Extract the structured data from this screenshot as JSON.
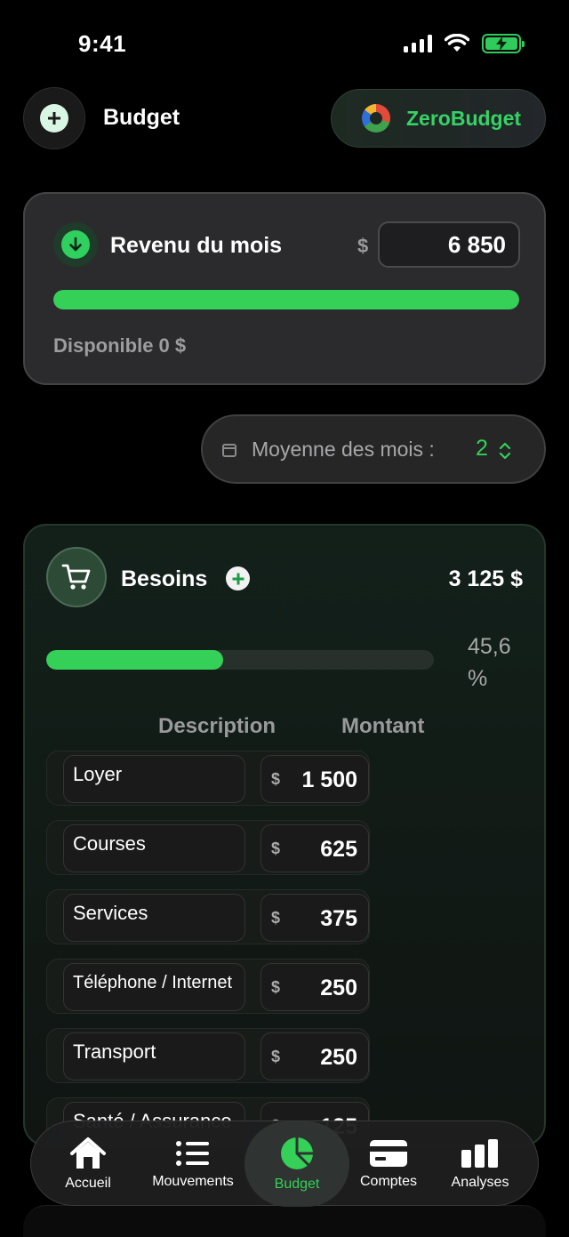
{
  "status_bar": {
    "time": "9:41"
  },
  "header": {
    "title": "Budget",
    "brand_name": "ZeroBudget"
  },
  "income": {
    "title": "Revenu du mois",
    "currency": "$",
    "amount": "6 850",
    "progress_fraction": 1.0,
    "available_text": "Disponible 0 $"
  },
  "months_average": {
    "label": "Moyenne des mois :",
    "value": "2"
  },
  "needs": {
    "title": "Besoins",
    "total": "3 125 $",
    "percent_text": "45,6 %",
    "percent_fraction": 0.456,
    "column_description": "Description",
    "column_amount": "Montant",
    "currency": "$",
    "rows": [
      {
        "description": "Loyer",
        "amount": "1 500"
      },
      {
        "description": "Courses",
        "amount": "625"
      },
      {
        "description": "Services",
        "amount": "375"
      },
      {
        "description": "Téléphone / Internet",
        "amount": "250"
      },
      {
        "description": "Transport",
        "amount": "250"
      },
      {
        "description": "Santé / Assurance",
        "amount": "125"
      }
    ]
  },
  "bottom_nav": {
    "items": [
      {
        "label": "Accueil",
        "icon": "home-icon"
      },
      {
        "label": "Mouvements",
        "icon": "list-icon"
      },
      {
        "label": "Budget",
        "icon": "pie-chart-icon",
        "active": true
      },
      {
        "label": "Comptes",
        "icon": "card-icon"
      },
      {
        "label": "Analyses",
        "icon": "bar-chart-icon"
      }
    ]
  },
  "colors": {
    "accent_green": "#34d058",
    "background": "#000000",
    "card": "#2b2b2d"
  }
}
